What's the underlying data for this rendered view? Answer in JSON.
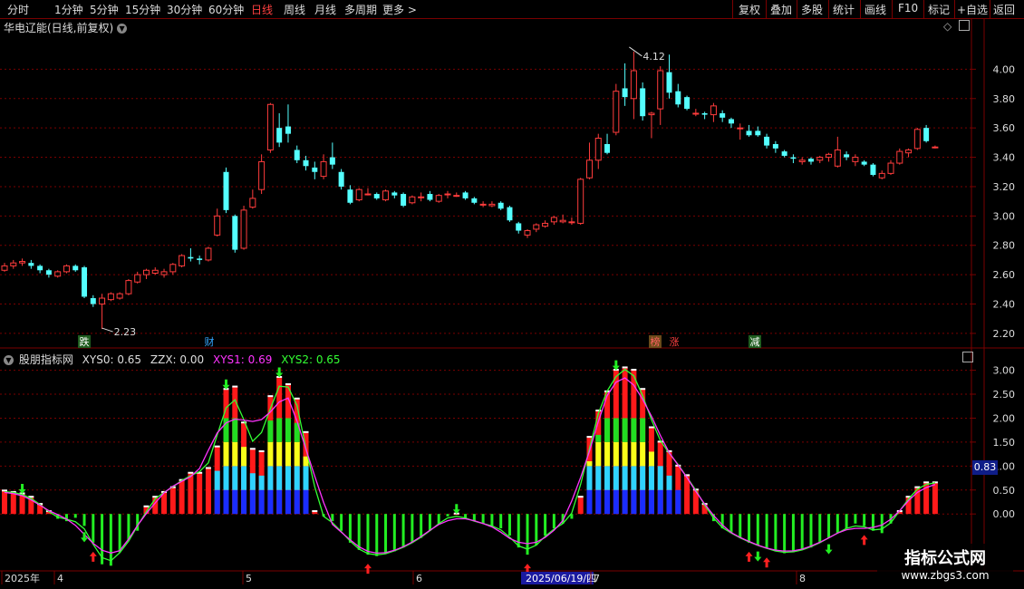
{
  "toolbar": {
    "left_tabs": [
      "分时",
      "1分钟",
      "5分钟",
      "15分钟",
      "30分钟",
      "60分钟",
      "日线",
      "周线",
      "月线",
      "多周期",
      "更多 >"
    ],
    "active_tab": "日线",
    "right_tabs": [
      "复权",
      "叠加",
      "多股",
      "统计",
      "画线",
      "F10",
      "标记",
      "+自选",
      "返回"
    ]
  },
  "main_chart": {
    "title": "华电辽能(日线,前复权)",
    "high_label": "4.12",
    "low_label": "2.23",
    "y_ticks": [
      "4.00",
      "3.80",
      "3.60",
      "3.40",
      "3.20",
      "3.00",
      "2.80",
      "2.60",
      "2.40",
      "2.20"
    ],
    "markers": [
      {
        "text": "跌",
        "color": "#ffffff",
        "bg": "#1f5d1f"
      },
      {
        "text": "财",
        "color": "#33a6ff",
        "bg": ""
      },
      {
        "text": "榜",
        "color": "#ff6060",
        "bg": "#6a4a1a"
      },
      {
        "text": "涨",
        "color": "#ff4040",
        "bg": ""
      },
      {
        "text": "减",
        "color": "#ffffff",
        "bg": "#1f5d1f"
      }
    ]
  },
  "indicator": {
    "name": "股朋指标网",
    "items": [
      {
        "text": "XYS0: 0.65",
        "color": "#dddddd"
      },
      {
        "text": "ZZX: 0.00",
        "color": "#dddddd"
      },
      {
        "text": "XYS1: 0.69",
        "color": "#ff33ff"
      },
      {
        "text": "XYS2: 0.65",
        "color": "#33ff33"
      }
    ],
    "y_ticks": [
      "3.00",
      "2.50",
      "2.00",
      "1.50",
      "1.00",
      "0.50",
      "0.00"
    ],
    "current_value": "0.83"
  },
  "time_axis": {
    "labels": [
      "2025年",
      "4",
      "5",
      "6",
      "2025/06/19/四",
      "7",
      "8"
    ]
  },
  "watermark": {
    "title": "指标公式网",
    "url": "www.zbgs3.com"
  },
  "colors": {
    "up": "#ff3c3c",
    "down": "#54ffff",
    "grid": "#7a0000",
    "axis_text": "#dddddd"
  },
  "chart_data": {
    "type": "candlestick",
    "ylim": [
      2.15,
      4.2
    ],
    "candles": [
      [
        2.63,
        2.66,
        2.68,
        2.62
      ],
      [
        2.66,
        2.68,
        2.7,
        2.64
      ],
      [
        2.68,
        2.69,
        2.71,
        2.66
      ],
      [
        2.68,
        2.66,
        2.7,
        2.64
      ],
      [
        2.66,
        2.63,
        2.67,
        2.61
      ],
      [
        2.63,
        2.6,
        2.64,
        2.58
      ],
      [
        2.59,
        2.62,
        2.63,
        2.58
      ],
      [
        2.62,
        2.66,
        2.67,
        2.61
      ],
      [
        2.66,
        2.63,
        2.67,
        2.62
      ],
      [
        2.65,
        2.45,
        2.66,
        2.44
      ],
      [
        2.44,
        2.4,
        2.46,
        2.38
      ],
      [
        2.4,
        2.44,
        2.47,
        2.23
      ],
      [
        2.43,
        2.47,
        2.48,
        2.42
      ],
      [
        2.44,
        2.47,
        2.48,
        2.43
      ],
      [
        2.47,
        2.56,
        2.57,
        2.46
      ],
      [
        2.55,
        2.6,
        2.62,
        2.54
      ],
      [
        2.6,
        2.63,
        2.64,
        2.57
      ],
      [
        2.61,
        2.63,
        2.65,
        2.6
      ],
      [
        2.6,
        2.62,
        2.64,
        2.58
      ],
      [
        2.62,
        2.67,
        2.68,
        2.6
      ],
      [
        2.66,
        2.73,
        2.74,
        2.65
      ],
      [
        2.72,
        2.71,
        2.78,
        2.69
      ],
      [
        2.71,
        2.7,
        2.73,
        2.67
      ],
      [
        2.7,
        2.78,
        2.79,
        2.69
      ],
      [
        2.87,
        3.0,
        3.05,
        2.86
      ],
      [
        3.3,
        3.04,
        3.33,
        3.02
      ],
      [
        3.0,
        2.77,
        3.01,
        2.75
      ],
      [
        2.78,
        3.04,
        3.07,
        2.77
      ],
      [
        3.06,
        3.12,
        3.18,
        3.05
      ],
      [
        3.18,
        3.37,
        3.42,
        3.15
      ],
      [
        3.45,
        3.76,
        3.77,
        3.43
      ],
      [
        3.6,
        3.5,
        3.7,
        3.47
      ],
      [
        3.61,
        3.56,
        3.76,
        3.5
      ],
      [
        3.45,
        3.38,
        3.48,
        3.36
      ],
      [
        3.38,
        3.34,
        3.41,
        3.31
      ],
      [
        3.33,
        3.3,
        3.37,
        3.25
      ],
      [
        3.27,
        3.37,
        3.42,
        3.25
      ],
      [
        3.4,
        3.35,
        3.5,
        3.32
      ],
      [
        3.3,
        3.2,
        3.32,
        3.18
      ],
      [
        3.18,
        3.09,
        3.21,
        3.08
      ],
      [
        3.11,
        3.18,
        3.19,
        3.1
      ],
      [
        3.15,
        3.15,
        3.19,
        3.14
      ],
      [
        3.15,
        3.12,
        3.16,
        3.11
      ],
      [
        3.11,
        3.17,
        3.18,
        3.1
      ],
      [
        3.16,
        3.14,
        3.17,
        3.12
      ],
      [
        3.15,
        3.07,
        3.16,
        3.06
      ],
      [
        3.09,
        3.13,
        3.14,
        3.08
      ],
      [
        3.13,
        3.13,
        3.16,
        3.1
      ],
      [
        3.15,
        3.11,
        3.17,
        3.1
      ],
      [
        3.1,
        3.14,
        3.15,
        3.09
      ],
      [
        3.15,
        3.15,
        3.17,
        3.12
      ],
      [
        3.14,
        3.14,
        3.16,
        3.13
      ],
      [
        3.16,
        3.12,
        3.17,
        3.11
      ],
      [
        3.12,
        3.09,
        3.13,
        3.08
      ],
      [
        3.08,
        3.08,
        3.1,
        3.06
      ],
      [
        3.07,
        3.08,
        3.1,
        3.06
      ],
      [
        3.09,
        3.05,
        3.1,
        3.04
      ],
      [
        3.06,
        2.97,
        3.07,
        2.96
      ],
      [
        2.95,
        2.9,
        2.96,
        2.88
      ],
      [
        2.87,
        2.9,
        2.91,
        2.85
      ],
      [
        2.91,
        2.94,
        2.95,
        2.89
      ],
      [
        2.93,
        2.95,
        2.97,
        2.92
      ],
      [
        2.96,
        2.99,
        3.0,
        2.94
      ],
      [
        2.96,
        2.97,
        3.01,
        2.95
      ],
      [
        2.96,
        2.96,
        2.99,
        2.94
      ],
      [
        2.95,
        3.25,
        3.26,
        2.94
      ],
      [
        3.26,
        3.38,
        3.5,
        3.25
      ],
      [
        3.38,
        3.53,
        3.56,
        3.32
      ],
      [
        3.49,
        3.43,
        3.56,
        3.42
      ],
      [
        3.57,
        3.85,
        3.9,
        3.55
      ],
      [
        3.87,
        3.81,
        4.04,
        3.75
      ],
      [
        3.8,
        3.99,
        4.12,
        3.66
      ],
      [
        3.87,
        3.68,
        3.91,
        3.65
      ],
      [
        3.69,
        3.7,
        3.71,
        3.53
      ],
      [
        3.73,
        3.99,
        4.02,
        3.62
      ],
      [
        3.98,
        3.84,
        4.1,
        3.8
      ],
      [
        3.85,
        3.76,
        3.9,
        3.74
      ],
      [
        3.81,
        3.73,
        3.82,
        3.72
      ],
      [
        3.7,
        3.7,
        3.73,
        3.68
      ],
      [
        3.7,
        3.69,
        3.71,
        3.66
      ],
      [
        3.69,
        3.75,
        3.77,
        3.64
      ],
      [
        3.7,
        3.67,
        3.72,
        3.64
      ],
      [
        3.66,
        3.63,
        3.67,
        3.6
      ],
      [
        3.6,
        3.6,
        3.63,
        3.52
      ],
      [
        3.58,
        3.55,
        3.62,
        3.54
      ],
      [
        3.58,
        3.55,
        3.61,
        3.54
      ],
      [
        3.54,
        3.48,
        3.56,
        3.46
      ],
      [
        3.49,
        3.46,
        3.51,
        3.43
      ],
      [
        3.44,
        3.41,
        3.45,
        3.4
      ],
      [
        3.4,
        3.39,
        3.42,
        3.36
      ],
      [
        3.37,
        3.38,
        3.4,
        3.35
      ],
      [
        3.39,
        3.37,
        3.4,
        3.35
      ],
      [
        3.38,
        3.4,
        3.41,
        3.36
      ],
      [
        3.4,
        3.42,
        3.43,
        3.37
      ],
      [
        3.34,
        3.45,
        3.54,
        3.33
      ],
      [
        3.42,
        3.4,
        3.44,
        3.38
      ],
      [
        3.37,
        3.4,
        3.42,
        3.34
      ],
      [
        3.37,
        3.35,
        3.38,
        3.34
      ],
      [
        3.35,
        3.28,
        3.36,
        3.27
      ],
      [
        3.26,
        3.29,
        3.31,
        3.25
      ],
      [
        3.29,
        3.36,
        3.38,
        3.28
      ],
      [
        3.36,
        3.44,
        3.46,
        3.35
      ],
      [
        3.43,
        3.45,
        3.46,
        3.4
      ],
      [
        3.46,
        3.59,
        3.6,
        3.45
      ],
      [
        3.6,
        3.51,
        3.62,
        3.5
      ],
      [
        3.47,
        3.47,
        3.48,
        3.46
      ]
    ],
    "indicator": {
      "ylim": [
        -1.15,
        3.2
      ],
      "values": [
        0.48,
        0.45,
        0.42,
        0.35,
        0.2,
        0.05,
        -0.1,
        -0.15,
        -0.08,
        -0.25,
        -0.6,
        -1.05,
        -1.08,
        -0.8,
        -0.55,
        -0.35,
        0.15,
        0.35,
        0.45,
        0.55,
        0.7,
        0.85,
        0.85,
        0.95,
        1.4,
        2.6,
        2.65,
        1.9,
        1.35,
        1.3,
        2.45,
        2.85,
        2.7,
        2.4,
        1.7,
        0.05,
        -0.05,
        -0.15,
        -0.35,
        -0.6,
        -0.75,
        -0.85,
        -0.88,
        -0.83,
        -0.78,
        -0.7,
        -0.6,
        -0.5,
        -0.35,
        -0.2,
        -0.05,
        0.0,
        -0.1,
        -0.15,
        -0.2,
        -0.25,
        -0.3,
        -0.45,
        -0.7,
        -0.85,
        -0.65,
        -0.45,
        -0.3,
        -0.2,
        -0.1,
        0.35,
        1.6,
        2.15,
        2.55,
        3.0,
        3.05,
        3.0,
        2.6,
        1.8,
        1.5,
        1.3,
        1.0,
        0.8,
        0.5,
        0.2,
        -0.15,
        -0.3,
        -0.4,
        -0.5,
        -0.6,
        -0.65,
        -0.72,
        -0.78,
        -0.82,
        -0.8,
        -0.75,
        -0.7,
        -0.6,
        -0.5,
        -0.4,
        -0.3,
        -0.2,
        -0.25,
        -0.35,
        -0.4,
        -0.2,
        0.05,
        0.35,
        0.55,
        0.65,
        0.65
      ],
      "stack_layers": [
        {
          "color": "#1a2dff",
          "top": 0.5
        },
        {
          "color": "#2fd3ff",
          "top": 1.0
        },
        {
          "color": "#f8ff1a",
          "top": 1.5
        },
        {
          "color": "#22dd22",
          "top": 2.0
        }
      ],
      "up_arrow_idx": [
        10,
        41,
        59,
        84,
        86,
        97
      ],
      "down_arrow_idx": [
        2,
        9,
        25,
        31,
        51,
        69,
        85,
        93
      ]
    }
  }
}
